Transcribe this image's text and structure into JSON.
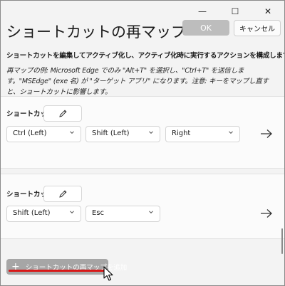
{
  "window": {
    "minimize_glyph": "—",
    "maximize_glyph": "☐",
    "close_glyph": "✕"
  },
  "header": {
    "title": "ショートカットの再マップ",
    "ok_label": "OK",
    "cancel_label": "キャンセル"
  },
  "description": {
    "main": "ショートカットを編集してアクティブ化し、アクティブ化時に実行するアクションを構成します。",
    "example": "再マップの例: Microsoft Edge でのみ \"Alt+T\" を選択し、\"Ctrl+T\" を送信します。\"MSEdge\" (exe 名) が \"ターゲット アプリ\" になります。注意: キーをマップし直すと、ショートカットに影響します。"
  },
  "rows": [
    {
      "label": "ショートカット:",
      "keys": [
        "Ctrl (Left)",
        "Shift (Left)",
        "Right"
      ]
    },
    {
      "label": "ショートカット:",
      "keys": [
        "Shift (Left)",
        "Esc"
      ]
    }
  ],
  "footer": {
    "add_label": "ショートカットの再マップを追加",
    "add_icon": "plus-icon"
  },
  "colors": {
    "ok_disabled": "#bdbdbd",
    "add_button": "#a6a6a6",
    "annotation_underline": "#d81818"
  }
}
